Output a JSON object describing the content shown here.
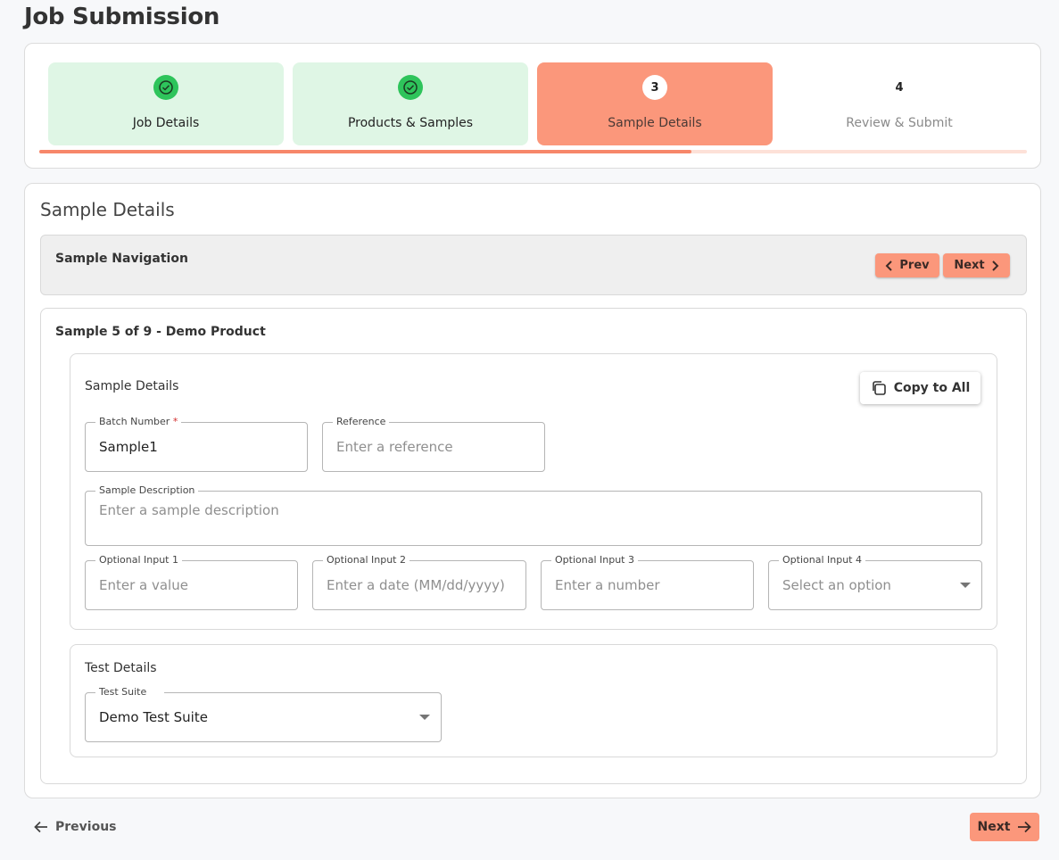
{
  "page": {
    "title": "Job Submission"
  },
  "stepper": {
    "steps": [
      {
        "label": "Job Details",
        "status": "complete",
        "badge": ""
      },
      {
        "label": "Products & Samples",
        "status": "complete",
        "badge": ""
      },
      {
        "label": "Sample Details",
        "status": "active",
        "badge": "3"
      },
      {
        "label": "Review & Submit",
        "status": "upcoming",
        "badge": "4"
      }
    ],
    "progress": 0.66
  },
  "main": {
    "title": "Sample Details",
    "navigation": {
      "label": "Sample Navigation",
      "prev_label": "Prev",
      "next_label": "Next"
    },
    "sample": {
      "title": "Sample 5 of 9 - Demo Product",
      "details": {
        "title": "Sample Details",
        "copy_label": "Copy to All",
        "batch_number": {
          "label": "Batch Number",
          "required_mark": "*",
          "value": "Sample1"
        },
        "reference": {
          "label": "Reference",
          "placeholder": "Enter a reference"
        },
        "description": {
          "label": "Sample Description",
          "placeholder": "Enter a sample description"
        },
        "optional1": {
          "label": "Optional Input 1",
          "placeholder": "Enter a value"
        },
        "optional2": {
          "label": "Optional Input 2",
          "placeholder": "Enter a date (MM/dd/yyyy)"
        },
        "optional3": {
          "label": "Optional Input 3",
          "placeholder": "Enter a number"
        },
        "optional4": {
          "label": "Optional Input 4",
          "placeholder": "Select an option"
        }
      },
      "tests": {
        "title": "Test Details",
        "test_suite": {
          "label": "Test Suite",
          "value": "Demo Test Suite"
        }
      }
    }
  },
  "footer": {
    "previous_label": "Previous",
    "next_label": "Next"
  },
  "colors": {
    "accent": "#fb977b",
    "complete_bg": "#dff6e5",
    "check_green": "#2ec45b"
  }
}
